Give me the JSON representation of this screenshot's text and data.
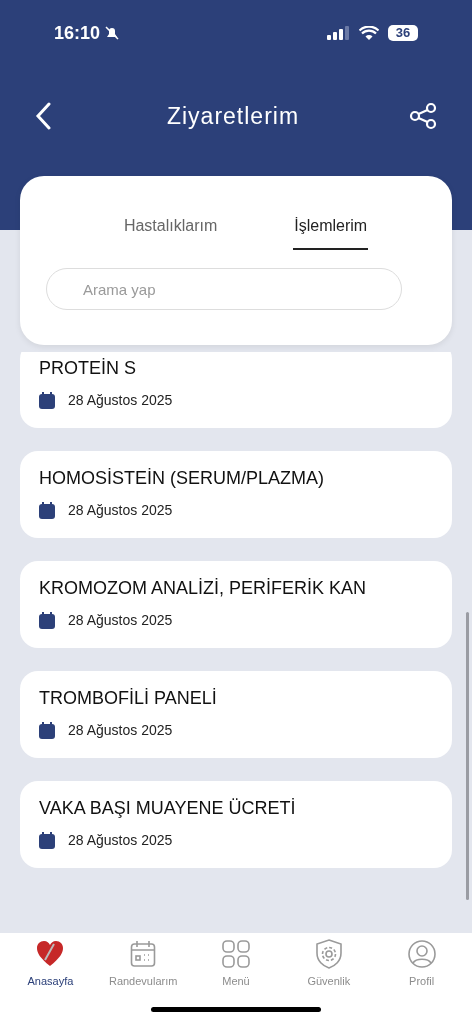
{
  "status_bar": {
    "time": "16:10",
    "battery": "36"
  },
  "header": {
    "title": "Ziyaretlerim"
  },
  "tabs": [
    {
      "label": "Hastalıklarım",
      "selected": false
    },
    {
      "label": "İşlemlerim",
      "selected": true
    }
  ],
  "search": {
    "placeholder": "Arama yap"
  },
  "records": [
    {
      "name": "PROTEİN S",
      "date": "28 Ağustos 2025"
    },
    {
      "name": "HOMOSİSTEİN (SERUM/PLAZMA)",
      "date": "28 Ağustos 2025"
    },
    {
      "name": "KROMOZOM ANALİZİ, PERİFERİK KAN",
      "date": "28 Ağustos 2025"
    },
    {
      "name": "TROMBOFİLİ PANELİ",
      "date": "28 Ağustos 2025"
    },
    {
      "name": "VAKA BAŞI MUAYENE ÜCRETİ",
      "date": "28 Ağustos 2025"
    }
  ],
  "bottom_nav": [
    {
      "label": "Anasayfa",
      "kind": "home",
      "selected": true
    },
    {
      "label": "Randevularım",
      "kind": "calendar",
      "selected": false
    },
    {
      "label": "Menü",
      "kind": "grid",
      "selected": false
    },
    {
      "label": "Güvenlik",
      "kind": "shield",
      "selected": false
    },
    {
      "label": "Profil",
      "kind": "profile",
      "selected": false
    }
  ]
}
